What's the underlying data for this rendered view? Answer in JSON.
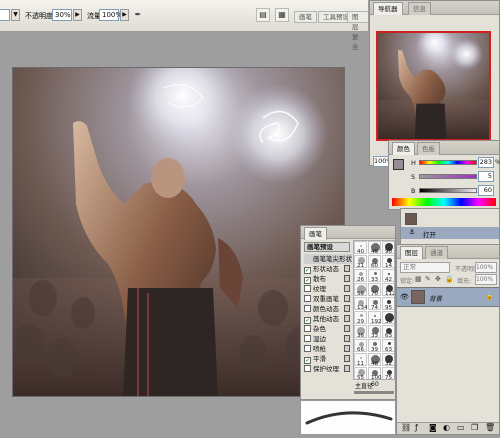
{
  "options_bar": {
    "opacity_label": "不透明度:",
    "opacity_value": "30%",
    "flow_label": "流量:",
    "flow_value": "100%",
    "airbrush_icon": "airbrush-icon",
    "tab_brushes": "画笔",
    "tab_tool": "工具预设",
    "tab_comps": "图层复合"
  },
  "navigator": {
    "tab_label": "导航器",
    "tab2": "信息",
    "zoom_value": "100%"
  },
  "color_panel": {
    "tab_label": "颜色",
    "tab2": "色板",
    "h_label": "H",
    "h_value": "283",
    "s_label": "S",
    "s_value": "5",
    "b_label": "B",
    "b_value": "60",
    "unit": "%"
  },
  "history": {
    "item_label": "打开"
  },
  "brushes": {
    "tab_label": "画笔",
    "header_label": "画笔预设",
    "items": [
      {
        "label": "画笔笔尖形状",
        "checked": false
      },
      {
        "label": "形状动态",
        "checked": true
      },
      {
        "label": "散布",
        "checked": true
      },
      {
        "label": "纹理",
        "checked": false
      },
      {
        "label": "双重画笔",
        "checked": false
      },
      {
        "label": "颜色动态",
        "checked": false
      },
      {
        "label": "其他动态",
        "checked": true
      },
      {
        "label": "杂色",
        "checked": false
      },
      {
        "label": "湿边",
        "checked": false
      },
      {
        "label": "喷枪",
        "checked": false
      },
      {
        "label": "平滑",
        "checked": true
      },
      {
        "label": "保护纹理",
        "checked": false
      }
    ],
    "tip_sizes": [
      "40",
      "45",
      "90",
      "21",
      "60",
      "14",
      "26",
      "33",
      "42",
      "55",
      "70",
      "112",
      "134",
      "74",
      "95",
      "29",
      "192",
      "36",
      "36",
      "33",
      "63",
      "66",
      "39",
      "63",
      "11",
      "48",
      "32",
      "55",
      "100",
      "75",
      "45"
    ],
    "master_diameter_label": "主直径",
    "master_diameter_value": "60"
  },
  "layers": {
    "tab_label": "图层",
    "tab2": "通道",
    "mode_value": "正常",
    "opacity_label": "不透明度:",
    "opacity_value": "100%",
    "lock_label": "锁定:",
    "fill_label": "填充:",
    "fill_value": "100%",
    "layer_name": "背景"
  },
  "colors": {
    "accent_red": "#d02020",
    "panel_bg": "#e3e1d8",
    "app_bg": "#9e9e9e"
  }
}
